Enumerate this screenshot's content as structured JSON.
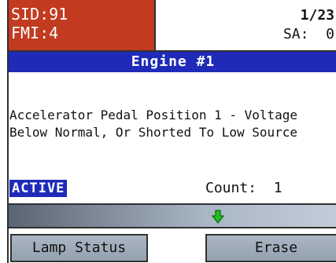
{
  "code": {
    "sid": "SID:91",
    "fmi": "FMI:4"
  },
  "meta": {
    "page": "1/23",
    "sa": "SA:  0"
  },
  "title": "Engine #1",
  "description": {
    "line1": "Accelerator Pedal Position 1 - Voltage",
    "line2": "Below Normal, Or Shorted To Low Source"
  },
  "status": "ACTIVE",
  "count": "Count:  1",
  "nav": {
    "icon": "arrow-down-icon",
    "icon_color": "#1fbf1f"
  },
  "buttons": {
    "lamp_status": "Lamp Status",
    "erase": "Erase"
  },
  "colors": {
    "code_bg": "#c23a1f",
    "title_bg": "#1f2bb8"
  }
}
